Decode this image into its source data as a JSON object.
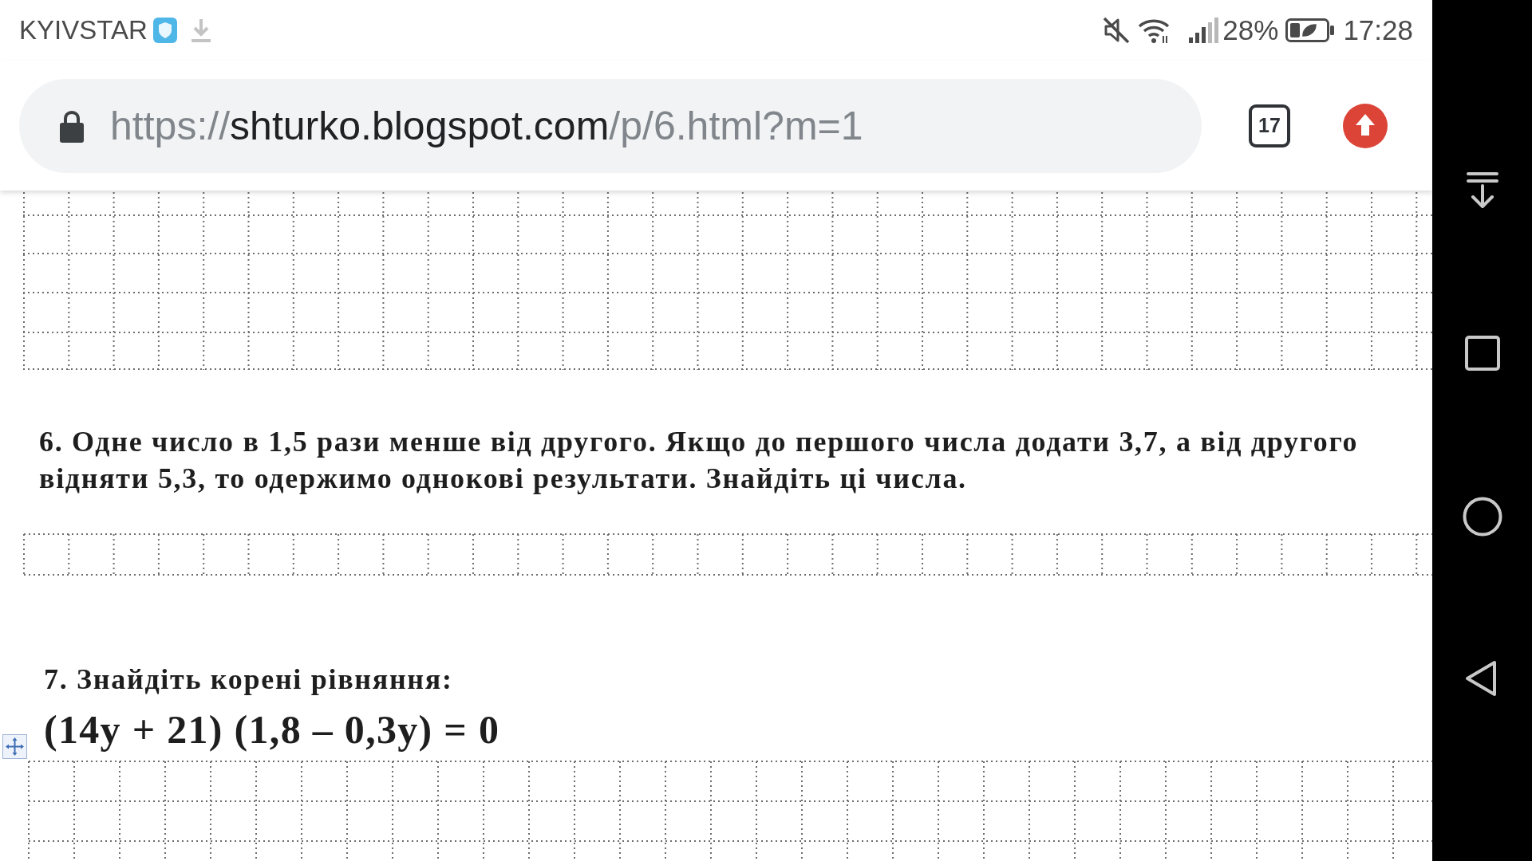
{
  "status_bar": {
    "carrier": "KYIVSTAR",
    "battery_percent": "28%",
    "time": "17:28"
  },
  "browser_toolbar": {
    "url": {
      "scheme": "https://",
      "host": "shturko.blogspot.com",
      "path": "/p/6.html?m=1"
    },
    "tab_count": "17"
  },
  "page": {
    "tasks": [
      {
        "text": "6. Одне число в 1,5 рази менше від другого. Якщо до першого числа додати 3,7, а від другого відняти 5,3, то одержимо однокові результати. Знайдіть ці числа."
      },
      {
        "text": "7. Знайдіть корені рівняння:",
        "equation": "(14y + 21) (1,8 – 0,3y) = 0"
      }
    ]
  }
}
